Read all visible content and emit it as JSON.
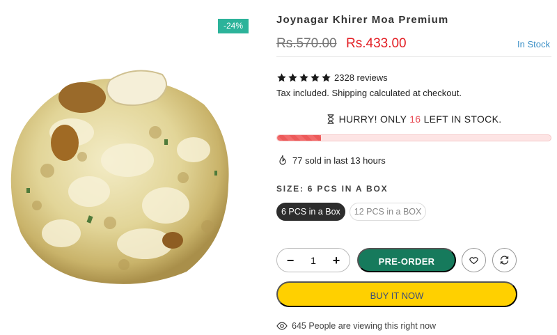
{
  "badge": {
    "discount": "-24%"
  },
  "product": {
    "title": "Joynagar Khirer Moa Premium",
    "old_price": "Rs.570.00",
    "new_price": "Rs.433.00",
    "stock_status": "In Stock",
    "rating_stars": 5,
    "reviews": "2328 reviews",
    "tax_note": "Tax included. Shipping calculated at checkout."
  },
  "hurry": {
    "prefix": "HURRY! ONLY ",
    "count": "16",
    "suffix": " LEFT IN STOCK.",
    "stock_fraction": 0.16
  },
  "sold": {
    "text": "77 sold in last 13 hours"
  },
  "size": {
    "label": "SIZE: 6 PCS IN A BOX",
    "options": [
      {
        "label": "6 PCS in a Box",
        "selected": true
      },
      {
        "label": "12 PCS in a BOX",
        "selected": false
      }
    ]
  },
  "quantity": {
    "minus": "−",
    "value": "1",
    "plus": "+"
  },
  "buttons": {
    "preorder": "PRE-ORDER",
    "buy_now": "BUY IT NOW"
  },
  "viewing": {
    "text": "645 People are viewing this right now"
  },
  "colors": {
    "badge": "#2cb39a",
    "price": "#e31e24",
    "stock": "#3a8fc6",
    "preorder": "#167a5c",
    "buy": "#ffd000",
    "hurry_count": "#e84c55"
  }
}
